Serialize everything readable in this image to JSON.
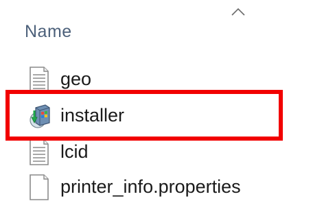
{
  "header": {
    "column_name": "Name",
    "sort_icon": "chevron-up-icon"
  },
  "files": [
    {
      "name": "geo",
      "icon": "text-document-icon"
    },
    {
      "name": "installer",
      "icon": "installer-package-icon"
    },
    {
      "name": "lcid",
      "icon": "text-document-icon"
    },
    {
      "name": "printer_info.properties",
      "icon": "blank-document-icon"
    }
  ],
  "highlight": {
    "target": "installer",
    "color": "#f20000"
  },
  "colors": {
    "header_text": "#4c607a",
    "file_text": "#1a1a1a",
    "background": "#ffffff"
  }
}
